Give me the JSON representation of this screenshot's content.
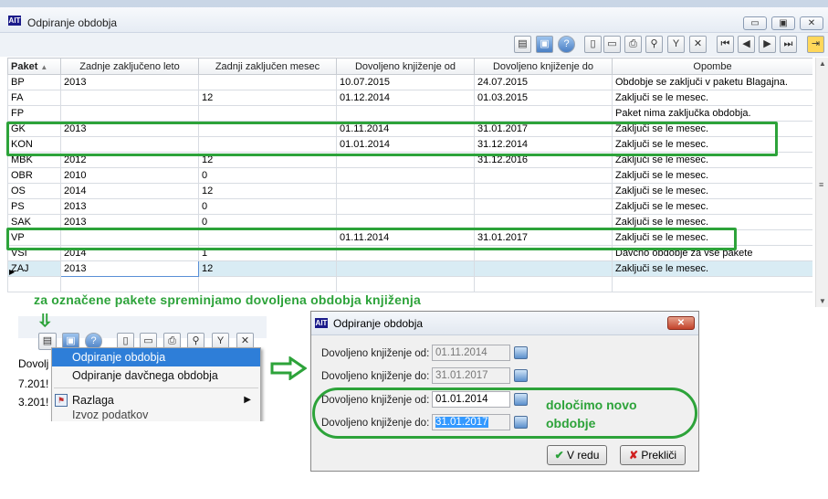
{
  "app": {
    "logo": "AIT",
    "title": "Odpiranje obdobja",
    "window_buttons": [
      "minimize-icon",
      "restore-icon",
      "close-icon"
    ]
  },
  "toolbar": {
    "icons": [
      "document-icon",
      "preview-icon",
      "help-icon",
      "new-icon",
      "open-folder-icon",
      "print-icon",
      "search-icon",
      "filter-icon",
      "clear-filter-icon",
      "first-record-icon",
      "previous-record-icon",
      "next-record-icon",
      "last-record-icon",
      "exit-icon"
    ]
  },
  "grid": {
    "columns": [
      "Paket",
      "Zadnje zaključeno leto",
      "Zadnji zaključen mesec",
      "Dovoljeno knjiženje od",
      "Dovoljeno knjiženje do",
      "Opombe"
    ],
    "sort_indicator": "▲",
    "row_pointer": "▶",
    "rows": [
      [
        "BP",
        "2013",
        "",
        "10.07.2015",
        "24.07.2015",
        "Obdobje se zaključi v paketu Blagajna."
      ],
      [
        "FA",
        "",
        "12",
        "01.12.2014",
        "01.03.2015",
        "Zaključi se le mesec."
      ],
      [
        "FP",
        "",
        "",
        "",
        "",
        "Paket nima zaključka obdobja."
      ],
      [
        "GK",
        "2013",
        "",
        "01.11.2014",
        "31.01.2017",
        "Zaključi se le mesec."
      ],
      [
        "KON",
        "",
        "",
        "01.01.2014",
        "31.12.2014",
        "Zaključi se le mesec."
      ],
      [
        "MBK",
        "2012",
        "12",
        "",
        "31.12.2016",
        "Zaključi se le mesec."
      ],
      [
        "OBR",
        "2010",
        "0",
        "",
        "",
        "Zaključi se le mesec."
      ],
      [
        "OS",
        "2014",
        "12",
        "",
        "",
        "Zaključi se le mesec."
      ],
      [
        "PS",
        "2013",
        "0",
        "",
        "",
        "Zaključi se le mesec."
      ],
      [
        "SAK",
        "2013",
        "0",
        "",
        "",
        "Zaključi se le mesec."
      ],
      [
        "VP",
        "",
        "",
        "01.11.2014",
        "31.01.2017",
        "Zaključi se le mesec."
      ],
      [
        "VSI",
        "2014",
        "1",
        "",
        "",
        "Davčno obdobje za vse pakete"
      ],
      [
        "ZAJ",
        "2013",
        "12",
        "",
        "",
        "Zaključi se le mesec."
      ],
      [
        "",
        "",
        "",
        "",
        "",
        ""
      ]
    ],
    "selected_row": 12
  },
  "annotations": {
    "note_top": "za označene pakete spreminjamo dovoljena obdobja knjiženja",
    "note_dialog_line1": "določimo novo",
    "note_dialog_line2": "obdobje",
    "highlight_color": "#2da33a"
  },
  "context_menu": {
    "partial_header": "Dovolj",
    "partial_values": [
      "7.201!",
      "3.201!"
    ],
    "items": [
      {
        "label": "Odpiranje obdobja",
        "highlighted": true
      },
      {
        "label": "Odpiranje davčnega obdobja",
        "highlighted": false
      },
      {
        "label": "Razlaga",
        "has_submenu": true
      },
      {
        "label": "Izvoz podatkov",
        "has_submenu": false
      }
    ]
  },
  "dialog": {
    "title": "Odpiranje obdobja",
    "fields": [
      {
        "label": "Dovoljeno knjiženje od:",
        "value": "01.11.2014",
        "disabled": true
      },
      {
        "label": "Dovoljeno knjiženje do:",
        "value": "31.01.2017",
        "disabled": true
      },
      {
        "label": "Dovoljeno knjiženje od:",
        "value": "01.01.2014",
        "disabled": false
      },
      {
        "label": "Dovoljeno knjiženje do:",
        "value": "31.01.2017",
        "disabled": false,
        "selected": true
      }
    ],
    "ok_label": "V redu",
    "cancel_label": "Prekliči"
  }
}
